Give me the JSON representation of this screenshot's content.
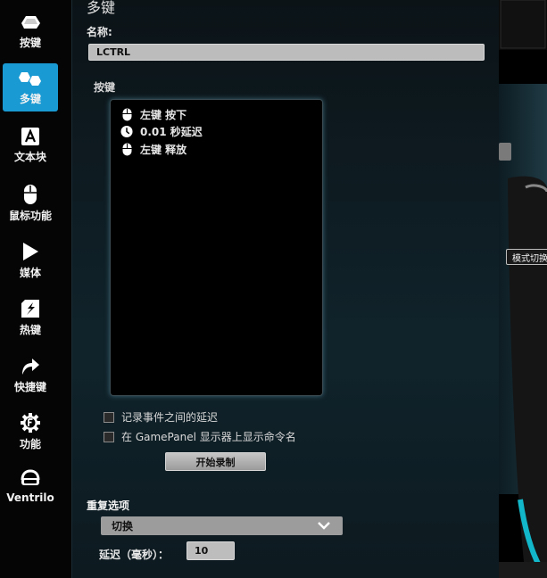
{
  "sidebar": {
    "items": [
      {
        "label": "按键",
        "icon": "key-icon",
        "active": false
      },
      {
        "label": "多键",
        "icon": "multikey-icon",
        "active": true
      },
      {
        "label": "文本块",
        "icon": "text-block-icon",
        "active": false
      },
      {
        "label": "鼠标功能",
        "icon": "mouse-icon",
        "active": false
      },
      {
        "label": "媒体",
        "icon": "play-icon",
        "active": false
      },
      {
        "label": "热键",
        "icon": "hotkey-icon",
        "active": false
      },
      {
        "label": "快捷键",
        "icon": "shortcut-arrow-icon",
        "active": false
      },
      {
        "label": "功能",
        "icon": "function-gear-icon",
        "active": false
      },
      {
        "label": "Ventrilo",
        "icon": "headset-icon",
        "active": false
      }
    ]
  },
  "panel": {
    "title": "多键",
    "name_label": "名称:",
    "name_value": "LCTRL",
    "keys_label": "按键",
    "events": [
      {
        "text": "左键 按下",
        "icon": "mouse-icon"
      },
      {
        "text": "0.01 秒延迟",
        "icon": "clock-icon"
      },
      {
        "text": "左键 释放",
        "icon": "mouse-icon"
      }
    ],
    "checkbox_record_delay": "记录事件之间的延迟",
    "checkbox_show_gamepanel": "在 GamePanel 显示器上显示命令名",
    "record_button": "开始录制",
    "repeat_label": "重复选项",
    "repeat_value": "切换",
    "delay_label": "延迟（毫秒）：",
    "delay_value": "10"
  },
  "background": {
    "tooltip": "模式切换"
  },
  "colors": {
    "accent": "#1a9ad3",
    "panel_bg": "#0e1b21",
    "glow": "#3b6574",
    "mouse_accent": "#12b7c9"
  }
}
